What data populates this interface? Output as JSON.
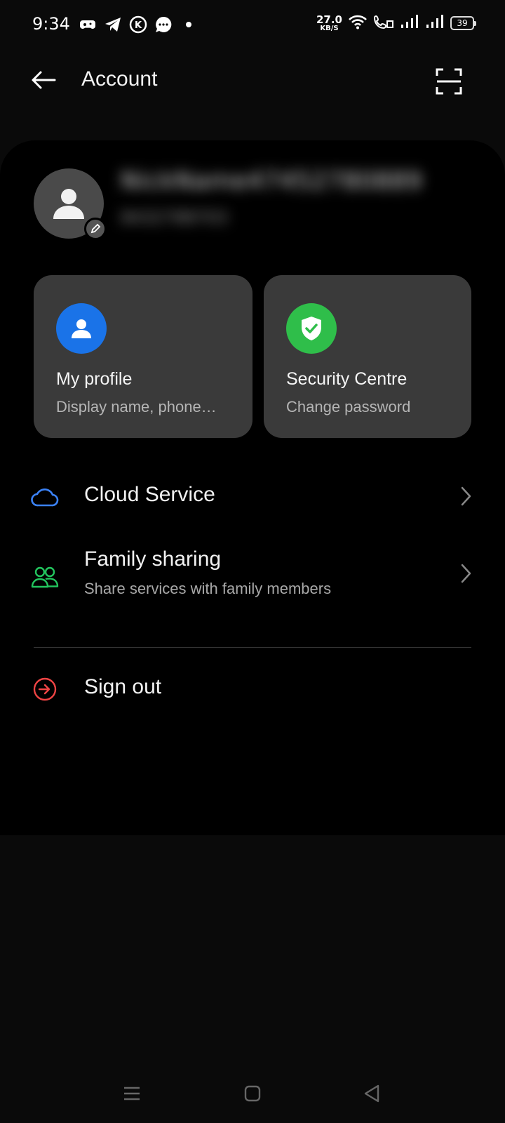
{
  "status_bar": {
    "time": "9:34",
    "net_speed_value": "27.0",
    "net_speed_unit": "KB/S",
    "battery_level": "39",
    "left_icons": [
      "gamepad-icon",
      "telegram-icon",
      "k-icon",
      "chat-icon",
      "dot-icon"
    ],
    "right_icons": [
      "wifi-icon",
      "volte-call-icon",
      "signal-icon",
      "signal-icon"
    ]
  },
  "header": {
    "title": "Account"
  },
  "profile": {
    "user_name": "NickName47452780889",
    "user_id": "8432788703"
  },
  "cards": [
    {
      "title": "My profile",
      "subtitle": "Display name, phone…",
      "icon": "person-icon",
      "color": "#1a73e8"
    },
    {
      "title": "Security Centre",
      "subtitle": "Change password",
      "icon": "shield-check-icon",
      "color": "#2fbe4a"
    }
  ],
  "menu": {
    "cloud_service": {
      "title": "Cloud Service",
      "icon": "cloud-icon",
      "color": "#3b82f6"
    },
    "family_sharing": {
      "title": "Family sharing",
      "subtitle": "Share services with family members",
      "icon": "family-icon",
      "color": "#22c55e"
    },
    "sign_out": {
      "title": "Sign out",
      "icon": "sign-out-icon",
      "color": "#ef4444"
    }
  },
  "nav_bar": {
    "icons": [
      "menu-icon",
      "home-icon",
      "back-triangle-icon"
    ]
  }
}
